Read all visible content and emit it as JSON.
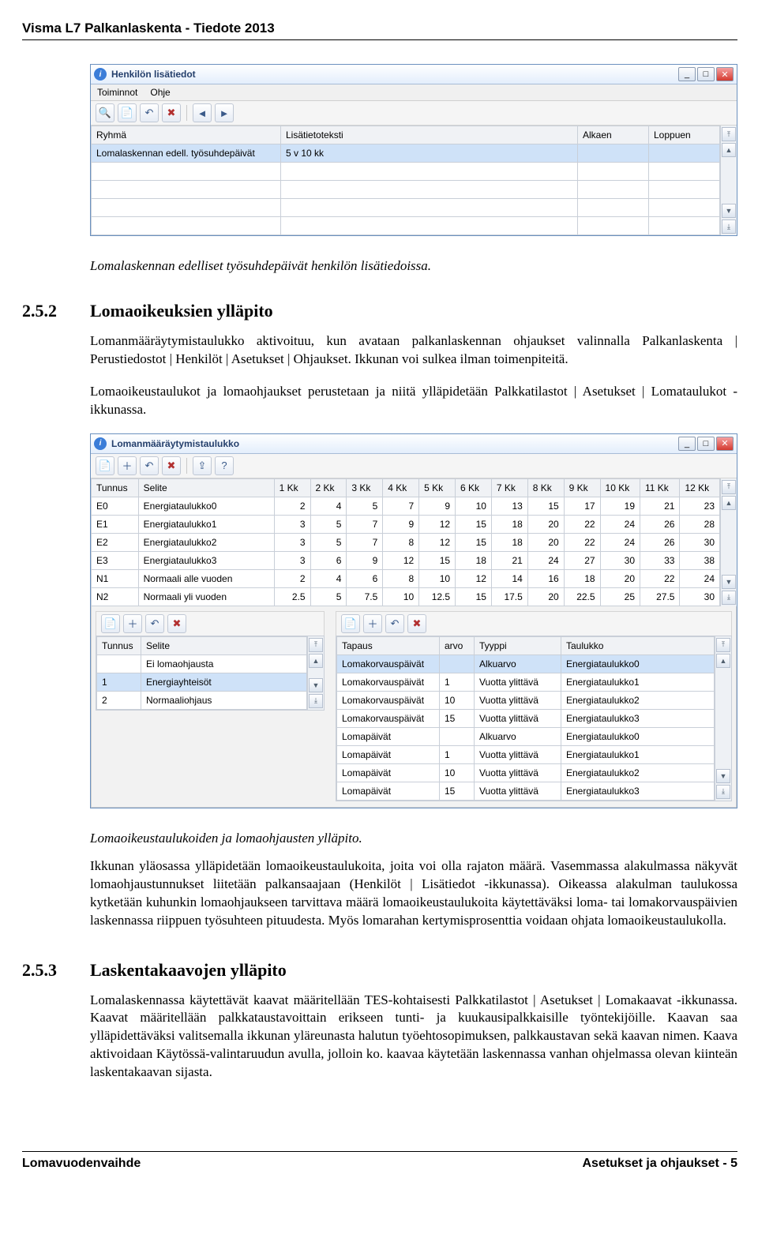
{
  "header": "Visma L7 Palkanlaskenta - Tiedote 2013",
  "win1": {
    "title": "Henkilön lisätiedot",
    "menus": [
      "Toiminnot",
      "Ohje"
    ],
    "cols": [
      "Ryhmä",
      "Lisätietoteksti",
      "Alkaen",
      "Loppuen"
    ],
    "row": [
      "Lomalaskennan edell. työsuhdepäivät",
      "5 v 10 kk",
      "",
      ""
    ]
  },
  "caption1": "Lomalaskennan edelliset työsuhdepäivät henkilön lisätiedoissa.",
  "h2_52_num": "2.5.2",
  "h2_52_txt": "Lomaoikeuksien ylläpito",
  "p1": "Lomanmääräytymistaulukko aktivoituu, kun avataan palkanlaskennan ohjaukset valinnalla Palkanlaskenta | Perustiedostot | Henkilöt | Asetukset | Ohjaukset. Ikkunan voi sulkea ilman toimenpiteitä.",
  "p2": "Lomaoikeustaulukot ja lomaohjaukset perustetaan ja niitä ylläpidetään Palkkatilastot | Asetukset | Lomataulukot -ikkunassa.",
  "win2": {
    "title": "Lomanmääräytymistaulukko",
    "cols": [
      "Tunnus",
      "Selite",
      "1 Kk",
      "2 Kk",
      "3 Kk",
      "4 Kk",
      "5 Kk",
      "6 Kk",
      "7 Kk",
      "8 Kk",
      "9 Kk",
      "10 Kk",
      "11 Kk",
      "12 Kk"
    ],
    "rows": [
      [
        "E0",
        "Energiataulukko0",
        "2",
        "4",
        "5",
        "7",
        "9",
        "10",
        "13",
        "15",
        "17",
        "19",
        "21",
        "23"
      ],
      [
        "E1",
        "Energiataulukko1",
        "3",
        "5",
        "7",
        "9",
        "12",
        "15",
        "18",
        "20",
        "22",
        "24",
        "26",
        "28"
      ],
      [
        "E2",
        "Energiataulukko2",
        "3",
        "5",
        "7",
        "8",
        "12",
        "15",
        "18",
        "20",
        "22",
        "24",
        "26",
        "30"
      ],
      [
        "E3",
        "Energiataulukko3",
        "3",
        "6",
        "9",
        "12",
        "15",
        "18",
        "21",
        "24",
        "27",
        "30",
        "33",
        "38"
      ],
      [
        "N1",
        "Normaali alle vuoden",
        "2",
        "4",
        "6",
        "8",
        "10",
        "12",
        "14",
        "16",
        "18",
        "20",
        "22",
        "24"
      ],
      [
        "N2",
        "Normaali yli vuoden",
        "2.5",
        "5",
        "7.5",
        "10",
        "12.5",
        "15",
        "17.5",
        "20",
        "22.5",
        "25",
        "27.5",
        "30"
      ]
    ],
    "left": {
      "cols": [
        "Tunnus",
        "Selite"
      ],
      "rows": [
        [
          "",
          "Ei lomaohjausta"
        ],
        [
          "1",
          "Energiayhteisöt"
        ],
        [
          "2",
          "Normaaliohjaus"
        ]
      ],
      "sel": 1
    },
    "right": {
      "cols": [
        "Tapaus",
        "arvo",
        "Tyyppi",
        "Taulukko"
      ],
      "rows": [
        [
          "Lomakorvauspäivät",
          "",
          "Alkuarvo",
          "Energiataulukko0"
        ],
        [
          "Lomakorvauspäivät",
          "1",
          "Vuotta ylittävä",
          "Energiataulukko1"
        ],
        [
          "Lomakorvauspäivät",
          "10",
          "Vuotta ylittävä",
          "Energiataulukko2"
        ],
        [
          "Lomakorvauspäivät",
          "15",
          "Vuotta ylittävä",
          "Energiataulukko3"
        ],
        [
          "Lomapäivät",
          "",
          "Alkuarvo",
          "Energiataulukko0"
        ],
        [
          "Lomapäivät",
          "1",
          "Vuotta ylittävä",
          "Energiataulukko1"
        ],
        [
          "Lomapäivät",
          "10",
          "Vuotta ylittävä",
          "Energiataulukko2"
        ],
        [
          "Lomapäivät",
          "15",
          "Vuotta ylittävä",
          "Energiataulukko3"
        ]
      ],
      "sel": 0
    }
  },
  "caption2": "Lomaoikeustaulukoiden ja lomaohjausten ylläpito.",
  "p3": "Ikkunan yläosassa ylläpidetään lomaoikeustaulukoita, joita voi olla rajaton määrä. Vasemmassa alakulmassa näkyvät lomaohjaustunnukset liitetään palkansaajaan (Henkilöt | Lisätiedot -ikkunassa). Oikeassa alakulman taulukossa kytketään kuhunkin lomaohjaukseen tarvittava määrä lomaoikeustaulukoita käytettäväksi loma- tai lomakorvauspäivien laskennassa riippuen työsuhteen pituudesta. Myös lomarahan kertymisprosenttia voidaan ohjata lomaoikeustaulukolla.",
  "h2_53_num": "2.5.3",
  "h2_53_txt": "Laskentakaavojen ylläpito",
  "p4": "Lomalaskennassa käytettävät kaavat määritellään TES-kohtaisesti Palkkatilastot | Asetukset | Lomakaavat -ikkunassa. Kaavat määritellään palkkataustavoittain erikseen tunti- ja kuukausipalkkaisille työntekijöille. Kaavan saa ylläpidettäväksi valitsemalla ikkunan yläreunasta halutun työehtosopimuksen, palkkaustavan sekä kaavan nimen. Kaava aktivoidaan Käytössä-valintaruudun avulla, jolloin ko. kaavaa käytetään laskennassa vanhan ohjelmassa olevan kiinteän laskentakaavan sijasta.",
  "footer_left": "Lomavuodenvaihde",
  "footer_right": "Asetukset ja ohjaukset - 5",
  "icons": {
    "search": "🔍",
    "new": "📄",
    "undo": "↶",
    "del": "✖",
    "back": "◄",
    "fwd": "►",
    "addrow": "＋",
    "delrow": "－",
    "exp": "⇪",
    "help": "?",
    "top": "⤒",
    "up": "▲",
    "down": "▼",
    "bot": "⤓",
    "min": "_",
    "max": "□",
    "close": "✕"
  }
}
